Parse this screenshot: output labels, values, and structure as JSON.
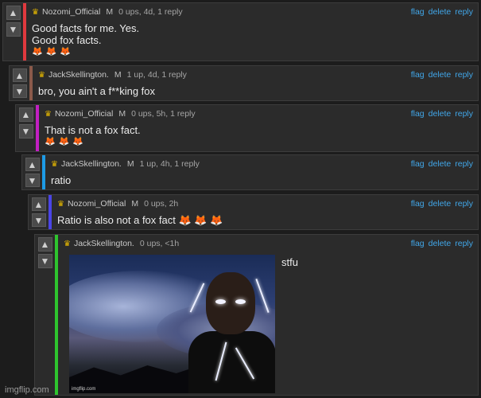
{
  "comments": [
    {
      "user": "Nozomi_Official",
      "mod": "M",
      "meta": "0 ups, 4d, 1 reply",
      "lines": [
        "Good facts for me. Yes.",
        "Good fox facts."
      ],
      "emoji": "🦊🦊🦊",
      "bar_color": "#e0393e"
    },
    {
      "user": "JackSkellington.",
      "mod": "M",
      "meta": "1 up, 4d, 1 reply",
      "lines": [
        "bro, you ain't a f**king fox"
      ],
      "emoji": "",
      "bar_color": "#8b5a4a"
    },
    {
      "user": "Nozomi_Official",
      "mod": "M",
      "meta": "0 ups, 5h, 1 reply",
      "lines": [
        "That is not a fox fact."
      ],
      "emoji": "🦊🦊🦊",
      "bar_color": "#c21fc2"
    },
    {
      "user": "JackSkellington.",
      "mod": "M",
      "meta": "1 up, 4h, 1 reply",
      "lines": [
        "ratio"
      ],
      "emoji": "",
      "bar_color": "#1d9be6"
    },
    {
      "user": "Nozomi_Official",
      "mod": "M",
      "meta": "0 ups, 2h",
      "lines": [
        "Ratio is also not a fox fact 🦊 🦊 🦊"
      ],
      "emoji": "",
      "bar_color": "#4b45e6"
    },
    {
      "user": "JackSkellington.",
      "mod": "",
      "meta": "0 ups, <1h",
      "text": "stfu",
      "image_watermark": "imgflip.com",
      "bar_color": "#2ec42e"
    }
  ],
  "actions": {
    "flag": "flag",
    "delete": "delete",
    "reply": "reply"
  },
  "vote_icons": {
    "up": "up-arrow-icon",
    "down": "down-arrow-icon"
  },
  "footer": "imgflip.com"
}
